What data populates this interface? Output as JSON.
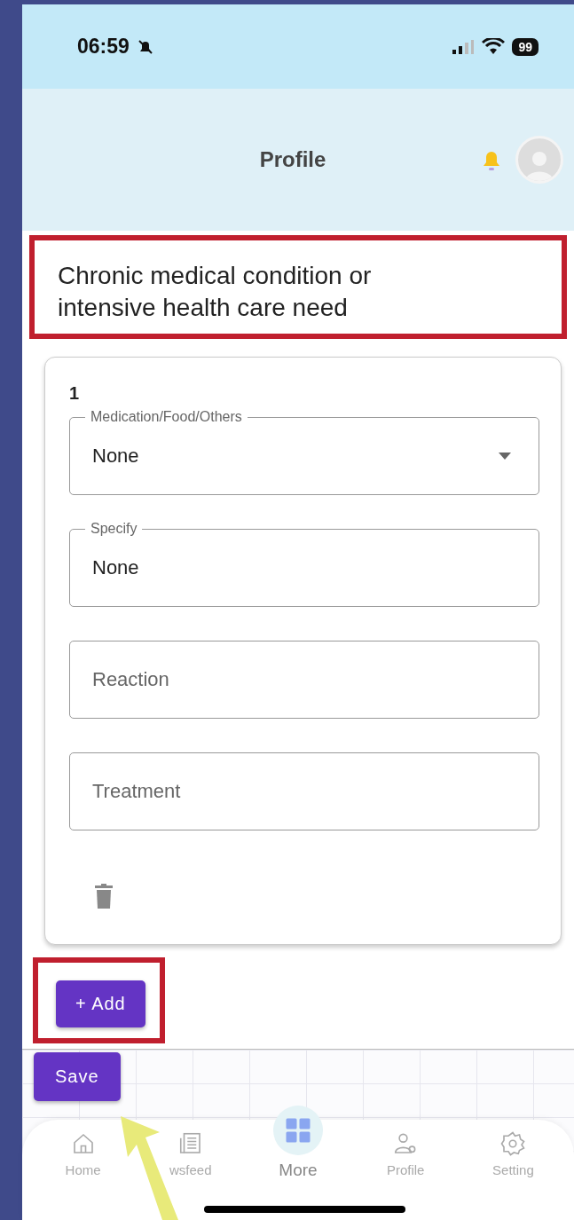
{
  "status_bar": {
    "time": "06:59",
    "battery": "99"
  },
  "header": {
    "title": "Profile"
  },
  "section_title": {
    "text": "Chronic medical condition or intensive health care need",
    "highlighted": true
  },
  "entries": [
    {
      "number": "1",
      "fields": [
        {
          "kind": "select",
          "label": "Medication/Food/Others",
          "value": "None"
        },
        {
          "kind": "text",
          "label": "Specify",
          "value": "None"
        },
        {
          "kind": "text",
          "placeholder": "Reaction"
        },
        {
          "kind": "text",
          "placeholder": "Treatment"
        }
      ]
    }
  ],
  "add_button": {
    "label": "+ Add",
    "highlighted": true
  },
  "save_button": {
    "label": "Save",
    "pointed_at": true
  },
  "bottom_nav": [
    {
      "kind": "tab",
      "label": "Home"
    },
    {
      "kind": "tab",
      "label": "wsfeed"
    },
    {
      "kind": "center",
      "label": "More"
    },
    {
      "kind": "tab",
      "label": "Profile"
    },
    {
      "kind": "tab",
      "label": "Setting"
    }
  ]
}
